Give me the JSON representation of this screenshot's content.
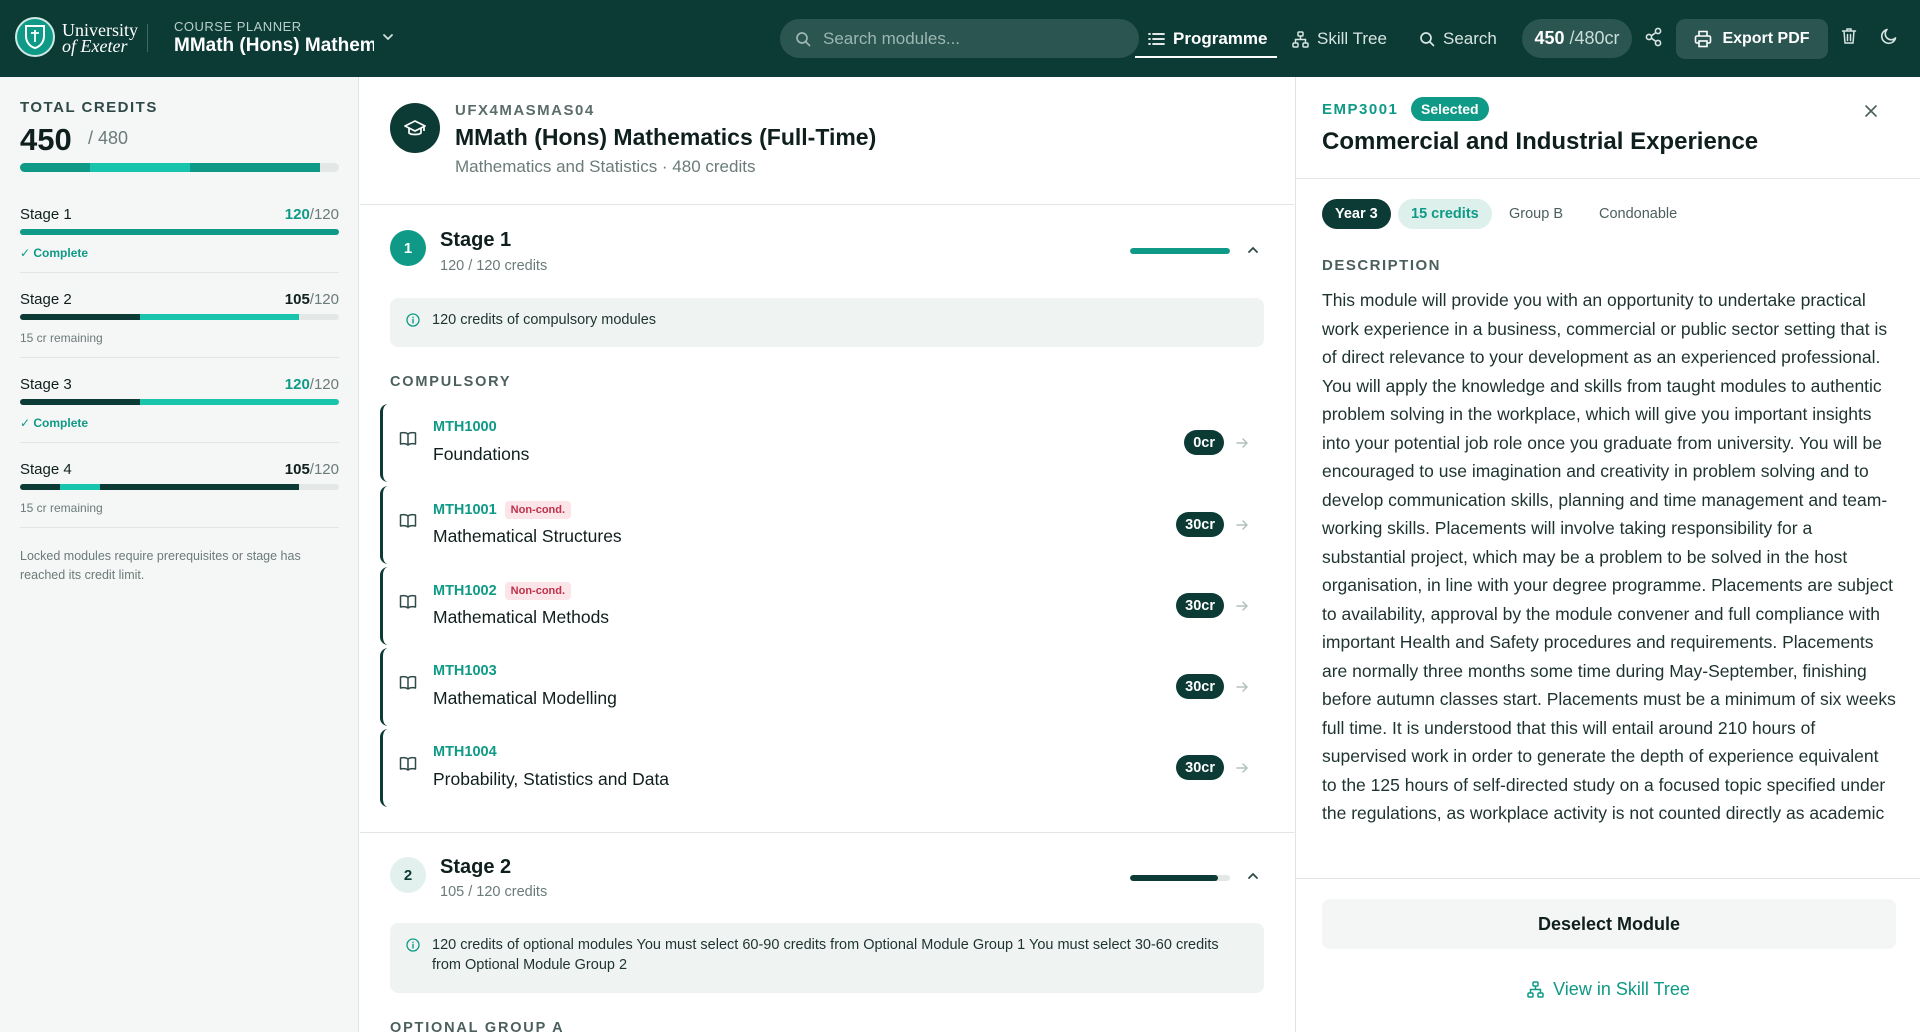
{
  "header": {
    "university": [
      "University",
      "of Exeter"
    ],
    "planner_label": "COURSE PLANNER",
    "planner_title": "MMath (Hons) Mathematics (Full-Time)",
    "search_placeholder": "Search modules...",
    "nav": [
      {
        "label": "Programme",
        "icon": "list-icon",
        "active": true
      },
      {
        "label": "Skill Tree",
        "icon": "skill-tree-icon",
        "active": false
      },
      {
        "label": "Search",
        "icon": "search-icon",
        "active": false
      }
    ],
    "credits_value": "450",
    "credits_max": "/480cr",
    "export_label": "Export PDF"
  },
  "sidebar": {
    "total_label": "TOTAL CREDITS",
    "total_value": "450",
    "total_max": "/ 480",
    "total_fraction": 0.9375,
    "stages": [
      {
        "name": "Stage 1",
        "value": "120",
        "max": "/120",
        "complete": true,
        "note": "Complete",
        "fraction": 1.0
      },
      {
        "name": "Stage 2",
        "value": "105",
        "max": "/120",
        "complete": false,
        "note": "15 cr remaining",
        "fraction": 0.875
      },
      {
        "name": "Stage 3",
        "value": "120",
        "max": "/120",
        "complete": true,
        "note": "Complete",
        "fraction": 1.0
      },
      {
        "name": "Stage 4",
        "value": "105",
        "max": "/120",
        "complete": false,
        "note": "15 cr remaining",
        "fraction": 0.875
      }
    ],
    "lock_note": "Locked modules require prerequisites or stage has reached its credit limit."
  },
  "programme": {
    "code": "UFX4MASMAS04",
    "title": "MMath (Hons) Mathematics (Full-Time)",
    "subtitle": "Mathematics and Statistics · 480 credits",
    "stages": [
      {
        "number": "1",
        "title": "Stage 1",
        "credits": "120 / 120 credits",
        "fraction": 1.0,
        "info": "120 credits of compulsory modules",
        "section_label": "COMPULSORY",
        "modules": [
          {
            "code": "MTH1000",
            "name": "Foundations",
            "credits": "0cr",
            "non_cond": false
          },
          {
            "code": "MTH1001",
            "name": "Mathematical Structures",
            "credits": "30cr",
            "non_cond": true
          },
          {
            "code": "MTH1002",
            "name": "Mathematical Methods",
            "credits": "30cr",
            "non_cond": true
          },
          {
            "code": "MTH1003",
            "name": "Mathematical Modelling",
            "credits": "30cr",
            "non_cond": false
          },
          {
            "code": "MTH1004",
            "name": "Probability, Statistics and Data",
            "credits": "30cr",
            "non_cond": false
          }
        ]
      },
      {
        "number": "2",
        "title": "Stage 2",
        "credits": "105 / 120 credits",
        "fraction": 0.875,
        "info": "120 credits of optional modules You must select 60-90 credits from Optional Module Group 1 You must select 30-60 credits from Optional Module Group 2",
        "section_label": "OPTIONAL GROUP A"
      }
    ],
    "non_cond_label": "Non-cond."
  },
  "detail": {
    "code": "EMP3001",
    "status": "Selected",
    "title": "Commercial and Industrial Experience",
    "chips": [
      "Year 3",
      "15 credits",
      "Group B",
      "Condonable"
    ],
    "description_label": "DESCRIPTION",
    "description": "This module will provide you with an opportunity to undertake practical work experience in a business, commercial or public sector setting that is of direct relevance to your development as an experienced professional. You will apply the knowledge and skills from taught modules to authentic problem solving in the workplace, which will give you important insights into your potential job role once you graduate from university. You will be encouraged to use imagination and creativity in problem solving and to develop communication skills, planning and time management and team-working skills. Placements will involve taking responsibility for a substantial project, which may be a problem to be solved in the host organisation, in line with your degree programme. Placements are subject to availability, approval by the module convener and full compliance with important Health and Safety procedures and requirements. Placements are normally three months some time during May-September, finishing before autumn classes start. Placements must be a minimum of six weeks full time. It is understood that this will entail around 210 hours of supervised work in order to generate the depth of experience equivalent to the 125 hours of self-directed study on a focused topic specified under the regulations, as workplace activity is not counted directly as academic",
    "deselect_label": "Deselect Module",
    "skill_tree_label": "View in Skill Tree"
  },
  "colors": {
    "header_bg": "#0c3a35",
    "accent": "#0e9a86",
    "accent_light": "#18c4ab",
    "danger": "#c0304a"
  }
}
